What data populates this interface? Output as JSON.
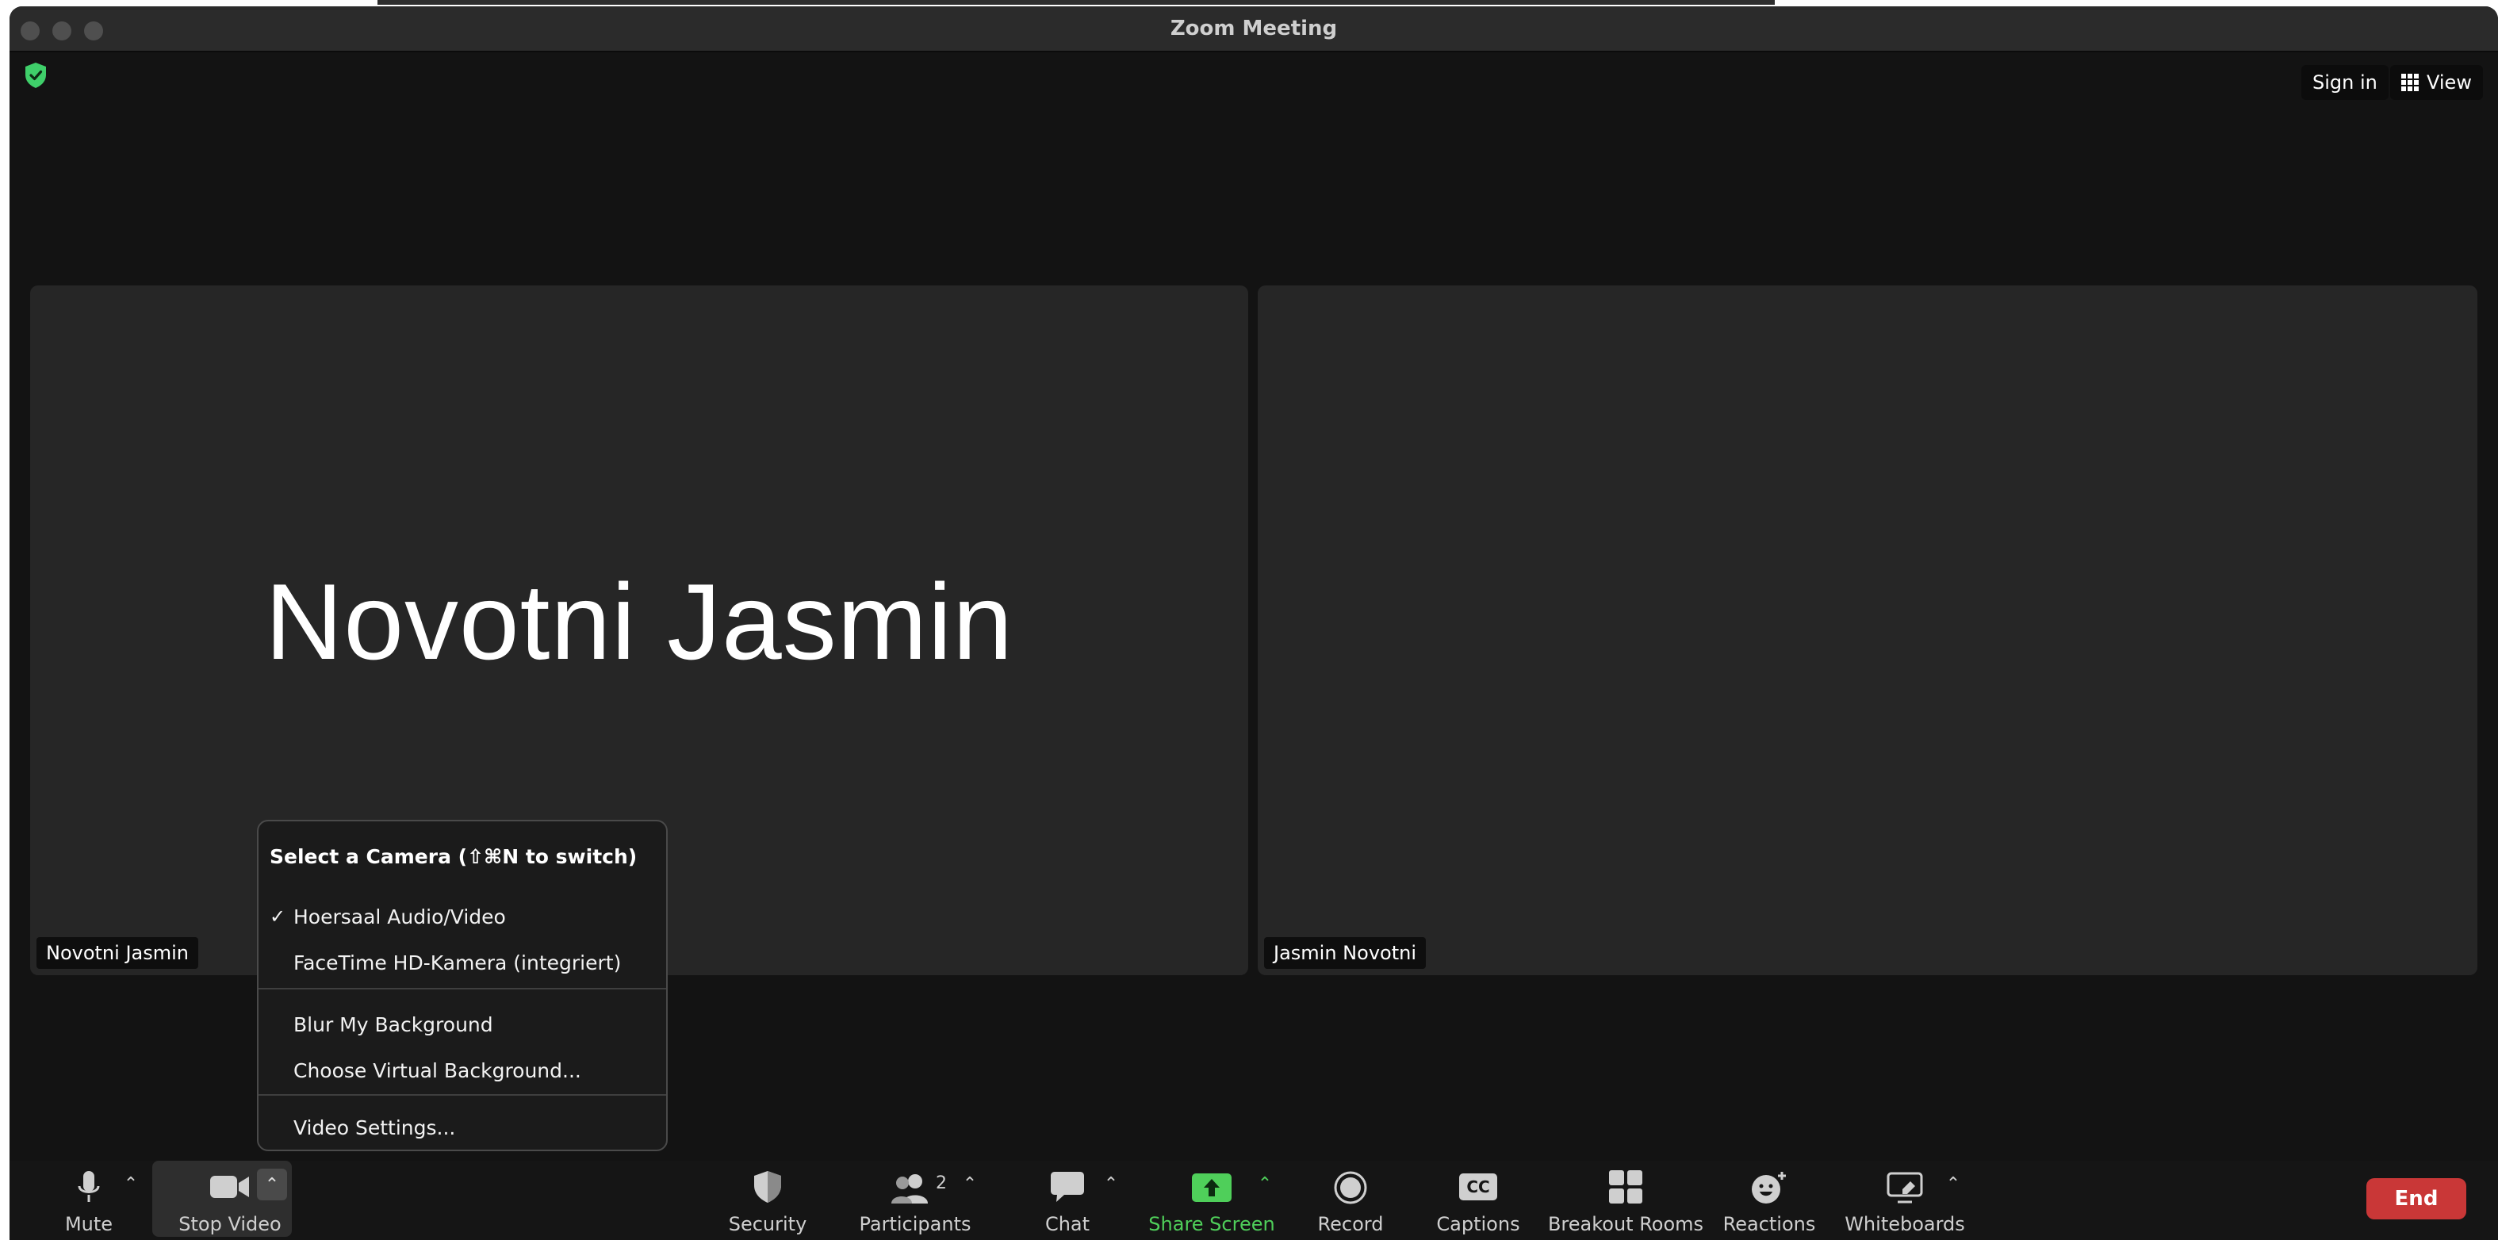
{
  "window": {
    "title": "Zoom Meeting"
  },
  "top_bar": {
    "sign_in_label": "Sign in",
    "view_label": "View"
  },
  "tiles": [
    {
      "big_name": "Novotni Jasmin",
      "name_tag": "Novotni Jasmin"
    },
    {
      "big_name": "",
      "name_tag": "Jasmin Novotni"
    }
  ],
  "camera_menu": {
    "header": "Select a Camera (⇧⌘N to switch)",
    "cameras": [
      {
        "label": "Hoersaal Audio/Video",
        "checked": true
      },
      {
        "label": "FaceTime HD-Kamera (integriert)",
        "checked": false
      }
    ],
    "check_mark": "✓",
    "background_items": [
      "Blur My Background",
      "Choose Virtual Background..."
    ],
    "settings_item": "Video Settings..."
  },
  "toolbar": {
    "mute": "Mute",
    "stop_video": "Stop Video",
    "security": "Security",
    "participants": "Participants",
    "participants_count": "2",
    "chat": "Chat",
    "share_screen": "Share Screen",
    "record": "Record",
    "captions": "Captions",
    "captions_badge": "CC",
    "breakout_rooms": "Breakout Rooms",
    "reactions": "Reactions",
    "whiteboards": "Whiteboards",
    "end": "End"
  },
  "colors": {
    "share_green": "#4fcf5a",
    "end_red": "#c93737",
    "security_shield": "#3fcf6a"
  }
}
